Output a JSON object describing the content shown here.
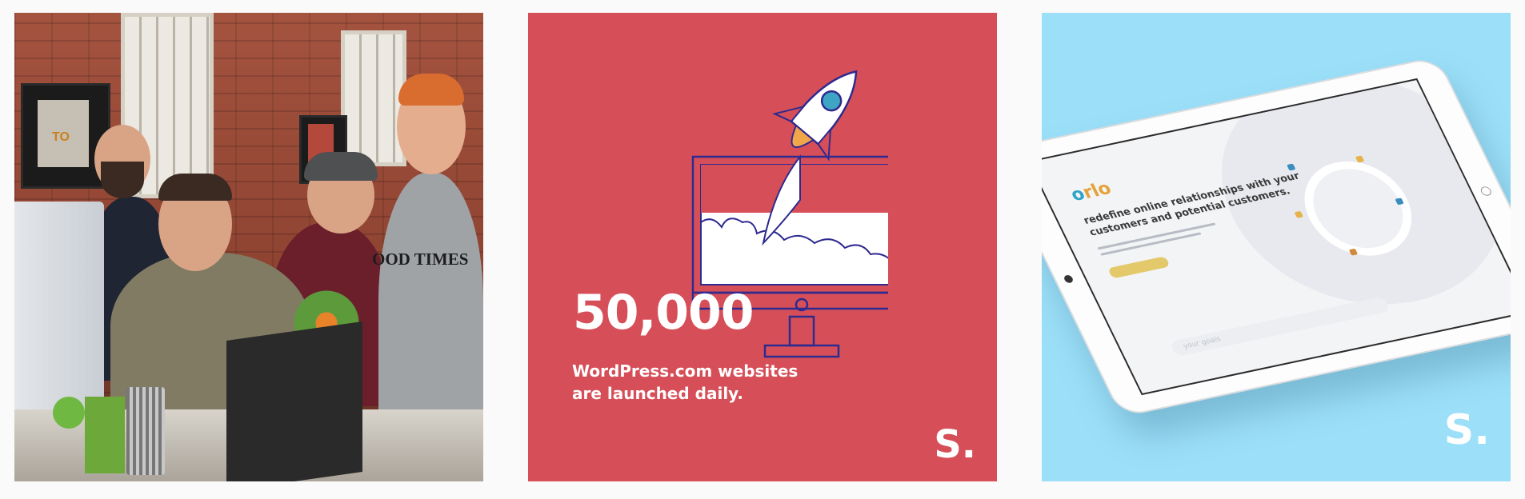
{
  "tiles": [
    {
      "id": "office-photo",
      "kind": "photo",
      "visible_text": {
        "wall_sign": "TO",
        "shirt_text": "OOD TIMES"
      }
    },
    {
      "id": "wordpress-stat",
      "kind": "graphic",
      "stat_number": "50,000",
      "stat_caption": "WordPress.com websites are launched daily.",
      "logo": "S.",
      "background": "#d64f58",
      "icon": "rocket-launch-from-monitor-icon"
    },
    {
      "id": "orlo-tablet",
      "kind": "graphic",
      "screen_logo": {
        "first": "o",
        "rest": "rlo"
      },
      "screen_headline": "redefine online relationships with your customers and potential customers.",
      "screen_input_placeholder": "your goals",
      "logo": "S.",
      "background": "#9cdff8"
    }
  ]
}
